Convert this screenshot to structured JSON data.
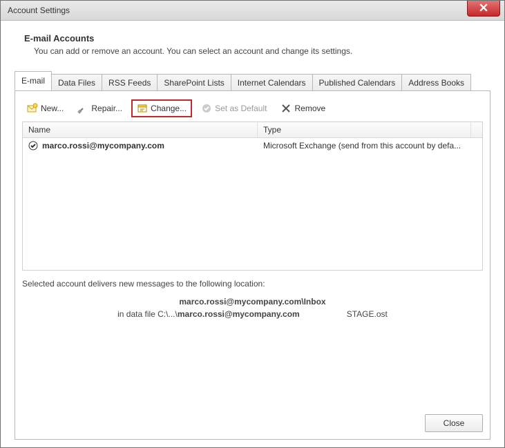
{
  "window": {
    "title": "Account Settings"
  },
  "header": {
    "title": "E-mail Accounts",
    "description": "You can add or remove an account. You can select an account and change its settings."
  },
  "tabs": {
    "items": [
      {
        "label": "E-mail"
      },
      {
        "label": "Data Files"
      },
      {
        "label": "RSS Feeds"
      },
      {
        "label": "SharePoint Lists"
      },
      {
        "label": "Internet Calendars"
      },
      {
        "label": "Published Calendars"
      },
      {
        "label": "Address Books"
      }
    ]
  },
  "toolbar": {
    "new_label": "New...",
    "repair_label": "Repair...",
    "change_label": "Change...",
    "set_default_label": "Set as Default",
    "remove_label": "Remove"
  },
  "list": {
    "columns": {
      "name": "Name",
      "type": "Type"
    },
    "rows": [
      {
        "name": "marco.rossi@mycompany.com",
        "type": "Microsoft Exchange (send from this account by defa..."
      }
    ]
  },
  "deliver": {
    "intro": "Selected account delivers new messages to the following location:",
    "account_folder": "marco.rossi@mycompany.com",
    "folder_suffix": "\\Inbox",
    "datafile_prefix": "in data file C:\\...\\",
    "datafile_name": "marco.rossi@mycompany.com",
    "ost_suffix": "STAGE.ost"
  },
  "footer": {
    "close_label": "Close"
  }
}
